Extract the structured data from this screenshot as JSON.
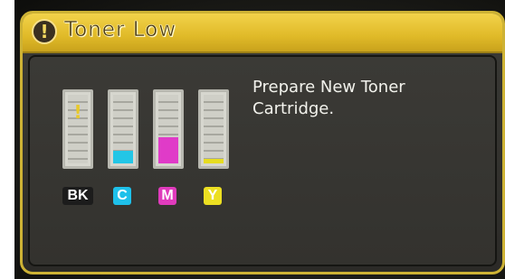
{
  "dialog": {
    "title": "Toner Low",
    "title_icon": "warning-exclamation-icon",
    "message_lines": [
      "Prepare New Toner",
      "Cartridge."
    ]
  },
  "toners": [
    {
      "label": "BK",
      "color": "#1a1a1a",
      "badge_bg": "#1c1c1c",
      "badge_fg": "#ffffff",
      "level_percent": 0,
      "warning_glyph": "!"
    },
    {
      "label": "C",
      "color": "#23c6e6",
      "badge_bg": "#1ec0ea",
      "badge_fg": "#ffffff",
      "level_percent": 18
    },
    {
      "label": "M",
      "color": "#e03bc8",
      "badge_bg": "#e03bbc",
      "badge_fg": "#ffffff",
      "level_percent": 38
    },
    {
      "label": "Y",
      "color": "#e6dc20",
      "badge_bg": "#ecdf22",
      "badge_fg": "#ffffff",
      "level_percent": 7
    }
  ],
  "colors": {
    "title_bar": "#e0ba28",
    "screen_bg": "#34332f",
    "bezel": "#cdb235"
  }
}
